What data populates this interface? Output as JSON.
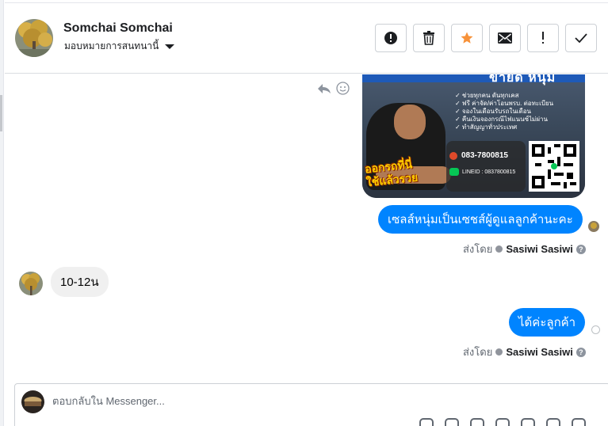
{
  "contact": {
    "name": "Somchai Somchai",
    "assign_label": "มอบหมายการสนทนานี้"
  },
  "header_actions": [
    {
      "icon": "alert-circle-icon",
      "name": "mark-spam-button"
    },
    {
      "icon": "trash-icon",
      "name": "delete-button"
    },
    {
      "icon": "star-icon",
      "name": "star-button",
      "color": "#f7923a"
    },
    {
      "icon": "envelope-icon",
      "name": "mark-unread-button"
    },
    {
      "icon": "exclamation-icon",
      "name": "follow-up-button"
    },
    {
      "icon": "check-icon",
      "name": "mark-done-button"
    }
  ],
  "ad": {
    "banner": "ขายดี หนุ่ม",
    "features": [
      "✓ ช่วยทุกคน ดันทุกเคส",
      "✓ ฟรี ค่าจัด/ค่าโอนพรบ. ต่อทะเบียน",
      "✓ จองในเดือนรับรถในเดือน",
      "✓ คืนเงินจองกรณีไฟแนนซ์ไม่ผ่าน",
      "✓ ทำสัญญาทั่วประเทศ"
    ],
    "phone": "083-7800815",
    "line_id": "LINEID : 0837800815",
    "slogan_line1": "ออกรถที่นี่",
    "slogan_line2": "ใช้แล้วรวย"
  },
  "messages": [
    {
      "direction": "out",
      "text": "เซลส์หนุ่มเป็นเซชส์ผู้ดูแลลูกค้านะคะ"
    },
    {
      "direction": "in",
      "text": "10-12น"
    },
    {
      "direction": "out",
      "text": "ได้ค่ะลูกค้า"
    }
  ],
  "sent_by": {
    "prefix": "ส่งโดย",
    "name": "Sasiwi Sasiwi",
    "help": "?"
  },
  "composer": {
    "placeholder": "ตอบกลับใน Messenger..."
  },
  "colors": {
    "accent_blue": "#0084ff",
    "star_orange": "#f7923a"
  }
}
